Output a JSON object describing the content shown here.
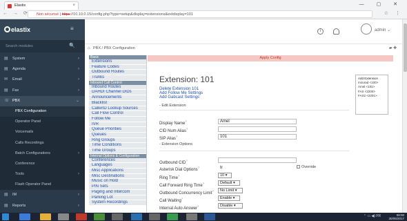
{
  "browser": {
    "tab_title": "Elastix",
    "tab_close": "×",
    "window_controls": "— ▢ ✕",
    "nav_buttons": "← → ⟳",
    "security_label": "Non sécurisé",
    "url_protocol": "https",
    "url_rest": "://10.10.0.15/config.php?type=setup&display=extensions&extdisplay=101",
    "addr_right_icons": "☆ ⋮"
  },
  "sidebar": {
    "logo": "elastix",
    "hamburger": "≡",
    "search_placeholder": "Search modules",
    "search_icon": "🔍",
    "items": [
      {
        "icon": "▤",
        "label": "System",
        "arrow": "›"
      },
      {
        "icon": "▤",
        "label": "Agenda",
        "arrow": "›"
      },
      {
        "icon": "✉",
        "label": "Email",
        "arrow": "›"
      },
      {
        "icon": "▤",
        "label": "Fax",
        "arrow": "›"
      },
      {
        "icon": "☏",
        "label": "PBX",
        "arrow": "⌄"
      },
      {
        "label": "PBX Configuration"
      },
      {
        "label": "Operator Panel"
      },
      {
        "label": "Voicemails"
      },
      {
        "label": "Calls Recordings"
      },
      {
        "label": "Batch Configurations",
        "arrow": "›"
      },
      {
        "label": "Conference"
      },
      {
        "label": "Tools",
        "arrow": "›"
      },
      {
        "label": "Flash Operator Panel"
      },
      {
        "icon": "▤",
        "label": "IM",
        "arrow": "›"
      },
      {
        "icon": "▤",
        "label": "Reports",
        "arrow": "›"
      }
    ]
  },
  "topbar": {
    "info_icon": "i",
    "bell_icon": "◌",
    "admin": "admin ⌄"
  },
  "breadcrumb": {
    "home_icon": "⌂",
    "path": "PBX  /  PBX Configuration",
    "right_icons": "▰ ✚"
  },
  "modules": [
    {
      "type": "header",
      "text": "Basic"
    },
    {
      "type": "link",
      "text": "Extensions"
    },
    {
      "type": "link",
      "text": "Feature Codes"
    },
    {
      "type": "link",
      "text": "Outbound Routes"
    },
    {
      "type": "link",
      "text": "Trunks"
    },
    {
      "type": "header",
      "text": "Inbound Call Control"
    },
    {
      "type": "link",
      "text": "Inbound Routes"
    },
    {
      "type": "link",
      "text": "DAHDI Channel DIDs"
    },
    {
      "type": "link",
      "text": "Announcements"
    },
    {
      "type": "link",
      "text": "Blacklist"
    },
    {
      "type": "link",
      "text": "CallerID Lookup Sources"
    },
    {
      "type": "link",
      "text": "Call Flow Control"
    },
    {
      "type": "link",
      "text": "Follow Me"
    },
    {
      "type": "link",
      "text": "IVR"
    },
    {
      "type": "link",
      "text": "Queue Priorities"
    },
    {
      "type": "link",
      "text": "Queues"
    },
    {
      "type": "link",
      "text": "Ring Groups"
    },
    {
      "type": "link",
      "text": "Time Conditions"
    },
    {
      "type": "link",
      "text": "Time Groups"
    },
    {
      "type": "header",
      "text": "Internal Options & Configuration"
    },
    {
      "type": "link",
      "text": "Conferences"
    },
    {
      "type": "link",
      "text": "Languages"
    },
    {
      "type": "link",
      "text": "Misc Applications"
    },
    {
      "type": "link",
      "text": "Misc Destinations"
    },
    {
      "type": "link",
      "text": "Music on Hold"
    },
    {
      "type": "link",
      "text": "PIN Sets"
    },
    {
      "type": "link",
      "text": "Paging and Intercom"
    },
    {
      "type": "link",
      "text": "Parking Lot"
    },
    {
      "type": "link",
      "text": "System Recordings"
    }
  ],
  "content": {
    "apply_config": "Apply Config",
    "title": "Extension: 101",
    "delete": "Delete Extension 101",
    "add_follow_me": "Add Follow Me Settings",
    "add_gabcast": "Add Gabcast Settings",
    "edit_section": "- Edit Extension",
    "display_name_label": "Display Name",
    "display_name_value": "Amel",
    "cid_alias_label": "CID Num Alias",
    "cid_alias_value": "",
    "sip_alias_label": "SIP Alias",
    "sip_alias_value": "101",
    "ext_options": "- Extension Options",
    "outbound_cid_label": "Outbound CID",
    "outbound_cid_value": "",
    "asterisk_dial_label": "Asterisk Dial Options",
    "asterisk_dial_value": "tr",
    "override_label": "Override",
    "ring_time_label": "Ring Time",
    "ring_time_value": "10 ▾",
    "cf_ring_time_label": "Call Forward Ring Time",
    "cf_ring_time_value": "Default ▾",
    "outbound_limit_label": "Outbound Concurrency Limit",
    "outbound_limit_value": "No Limit ▾",
    "call_waiting_label": "Call Waiting",
    "call_waiting_value": "Enable ▾",
    "internal_auto_label": "Internal Auto Answer",
    "internal_auto_value": "Disable ▾",
    "help": "?"
  },
  "ext_list": {
    "add": "Add Extension",
    "items": [
      "mourad <100>",
      "Amel <101>",
      "FAX <2200>",
      "FAX2 <2201>"
    ]
  },
  "taskbar": {
    "lang": "FR",
    "time": "08:00",
    "date": "30/05/2017",
    "tray_icons": "⌃ ▭ ◀)"
  },
  "colors": {
    "sidebar_bg": "#2b3a4a",
    "apply_bg": "#f6c8c4",
    "link": "#1f4fa8"
  }
}
